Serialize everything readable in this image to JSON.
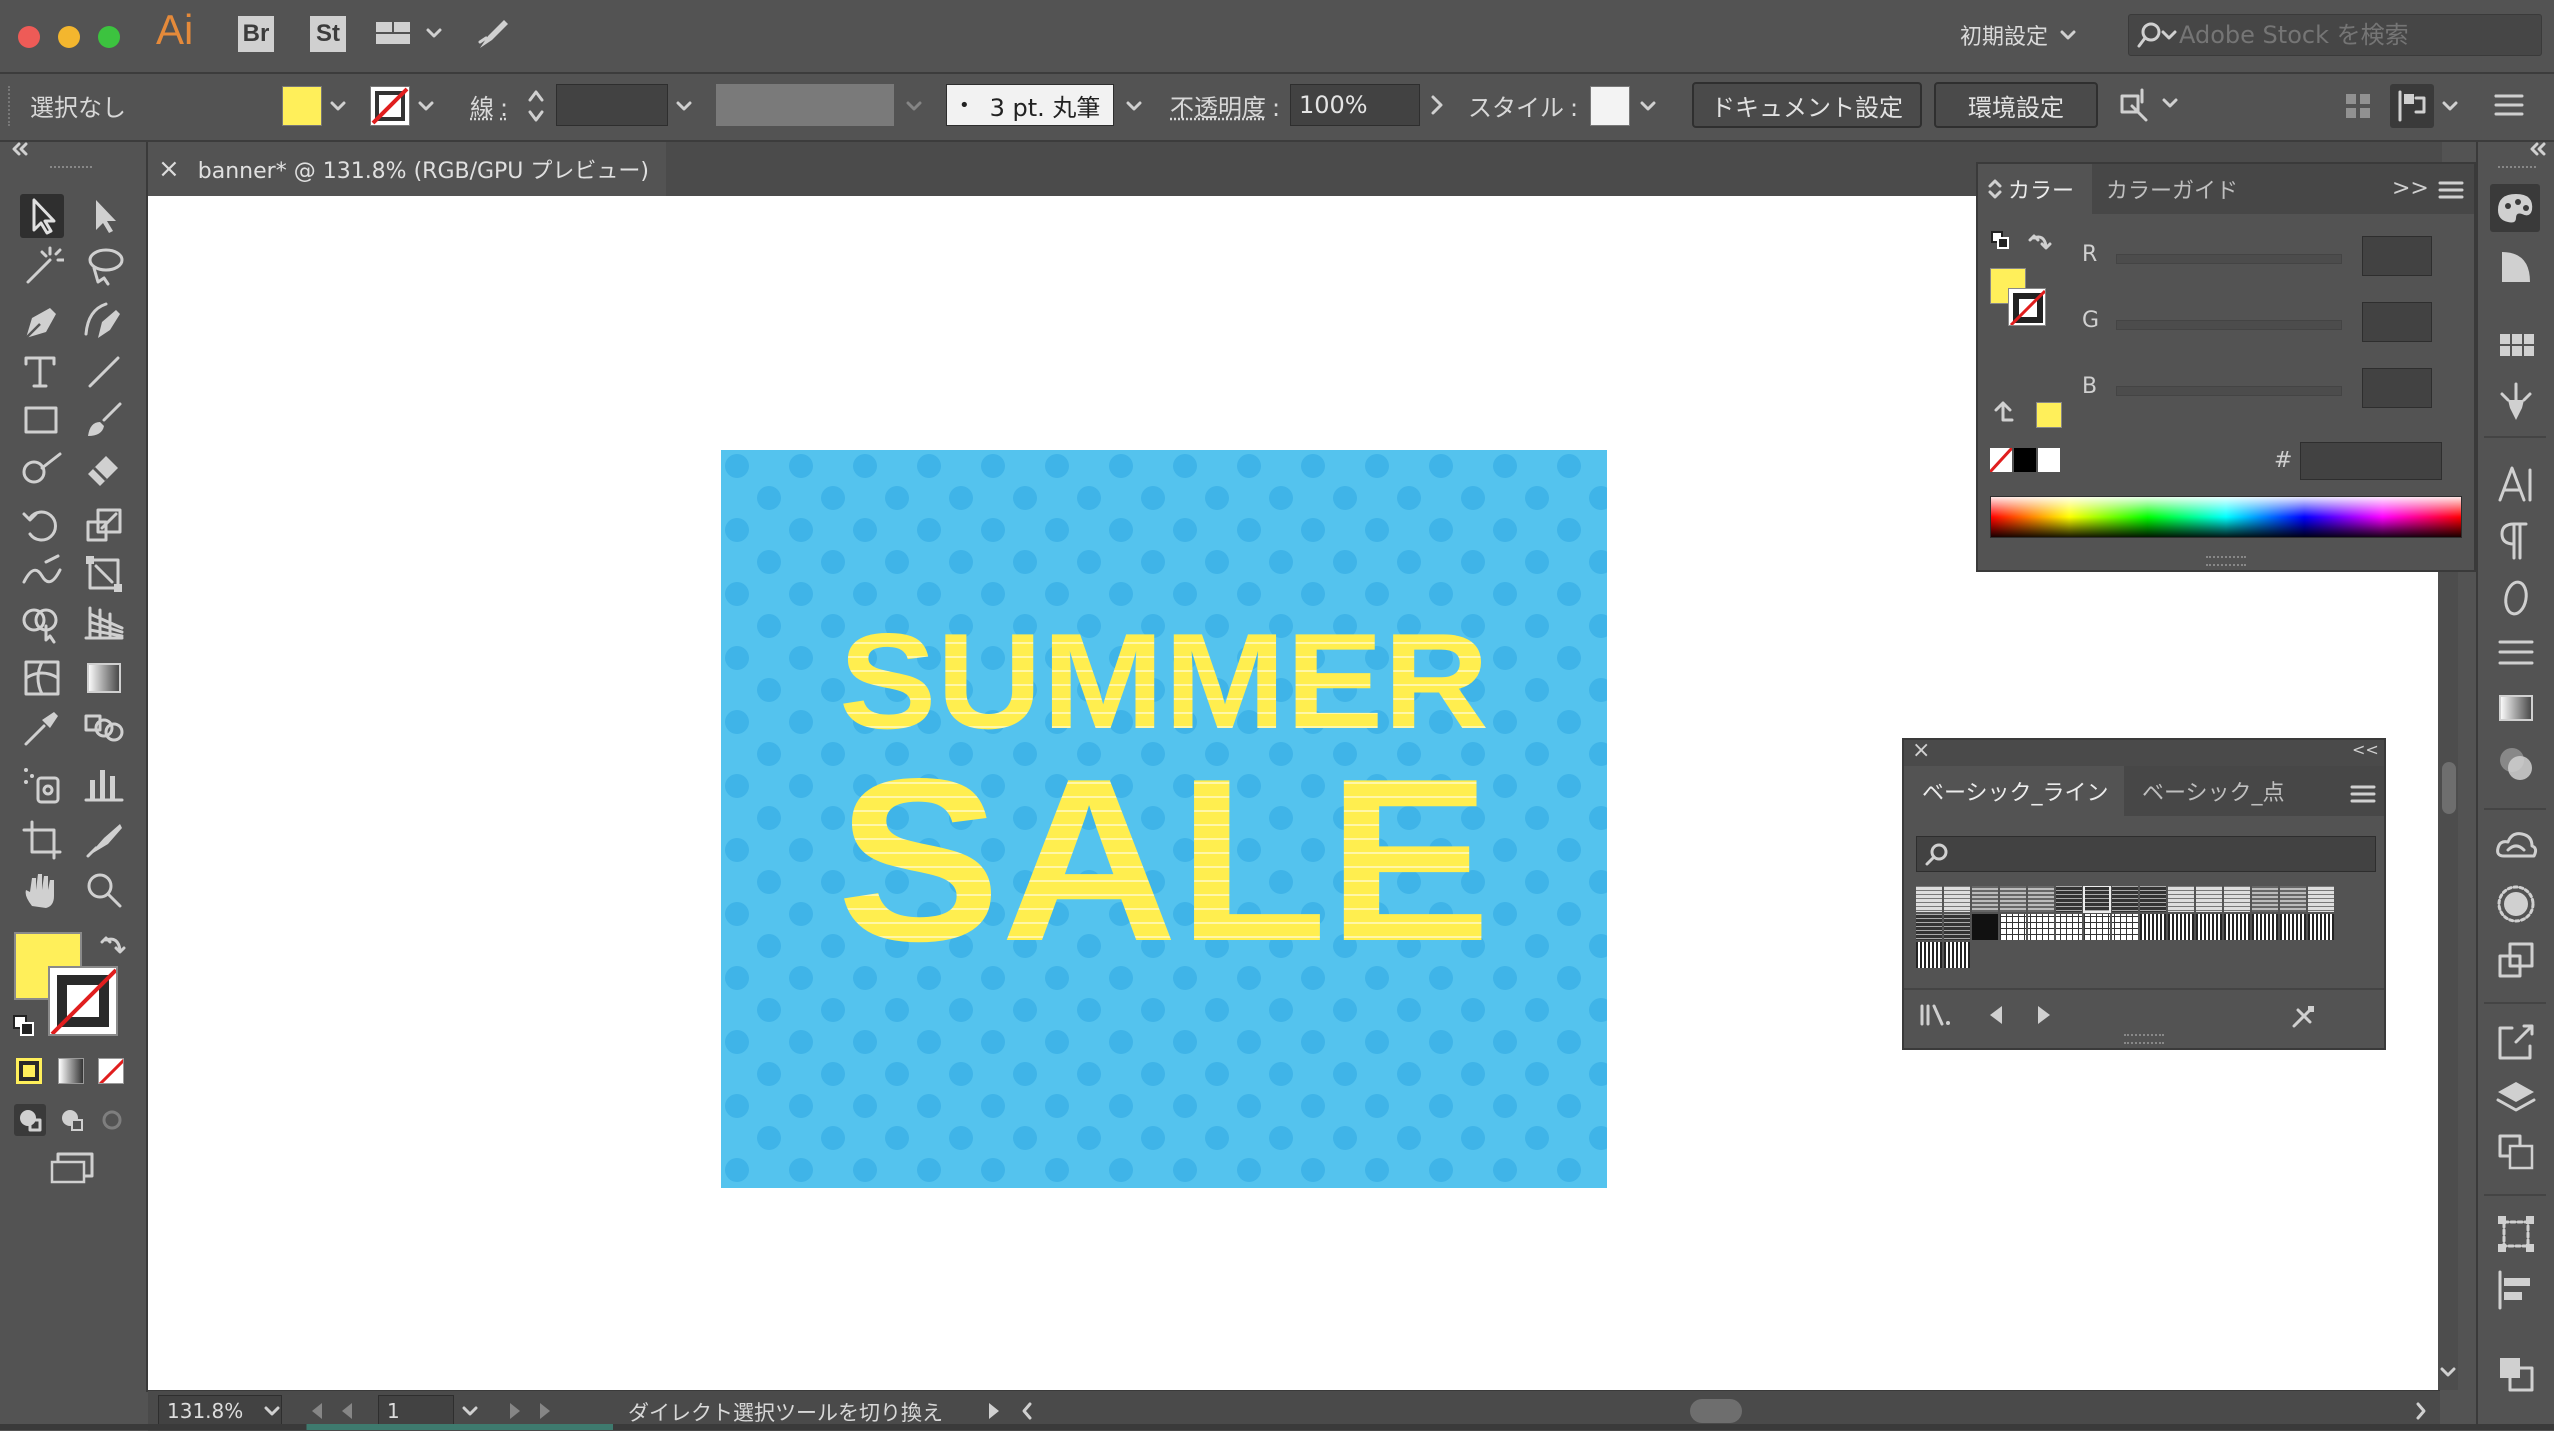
{
  "app": {
    "logo": "Ai",
    "bridge_label": "Br",
    "stock_label": "St",
    "workspace_label": "初期設定",
    "search_placeholder": "Adobe Stock を検索"
  },
  "control_bar": {
    "selection_status": "選択なし",
    "fill_color": "#ffef5a",
    "stroke_label": "線",
    "colon": ":",
    "brush_value": "3 pt. 丸筆",
    "brush_dot": "•",
    "opacity_label": "不透明度",
    "opacity_value": "100%",
    "style_label": "スタイル",
    "document_setup_label": "ドキュメント設定",
    "preferences_label": "環境設定"
  },
  "document_tab": {
    "close_glyph": "×",
    "title": "banner* @ 131.8% (RGB/GPU プレビュー)"
  },
  "artwork": {
    "background_color": "#54c3ee",
    "dot_color": "#3fb4e8",
    "text_color": "#ffee4f",
    "headline_top": "SUMMER",
    "headline_bottom": "SALE"
  },
  "color_panel": {
    "tab_active": "カラー",
    "tab_inactive": "カラーガイド",
    "expand_glyph": ">>",
    "channel_r": "R",
    "channel_g": "G",
    "channel_b": "B",
    "hash_label": "#"
  },
  "swatch_panel": {
    "close_glyph": "×",
    "collapse_glyph": "<<",
    "tab_active": "ベーシック_ライン",
    "tab_inactive": "ベーシック_点"
  },
  "status_bar": {
    "zoom_value": "131.8%",
    "artboard_number": "1",
    "status_text": "ダイレクト選択ツールを切り換え"
  }
}
